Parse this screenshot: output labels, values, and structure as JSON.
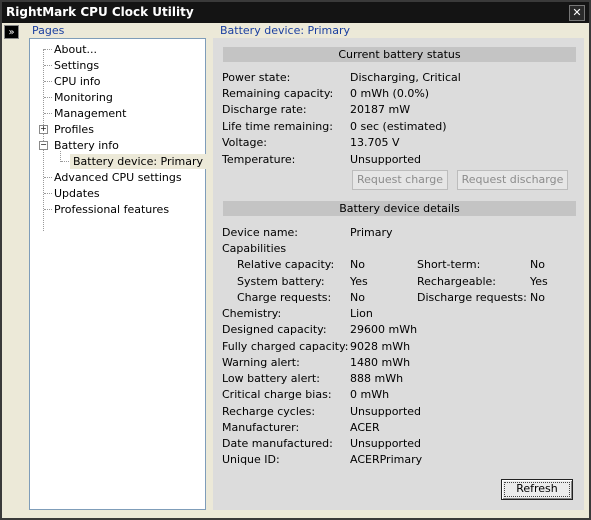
{
  "window": {
    "title": "RightMark CPU Clock Utility",
    "close_glyph": "✕"
  },
  "sidebar": {
    "expand_glyph": "»",
    "header": "Pages",
    "items": {
      "about": "About...",
      "settings": "Settings",
      "cpu_info": "CPU info",
      "monitoring": "Monitoring",
      "management": "Management",
      "profiles": "Profiles",
      "battery_info": "Battery info",
      "battery_device": "Battery device: Primary",
      "advanced_cpu": "Advanced CPU settings",
      "updates": "Updates",
      "professional": "Professional features"
    },
    "toggles": {
      "profiles": "+",
      "battery_info": "−"
    }
  },
  "breadcrumb": "Battery device: Primary",
  "status": {
    "header": "Current battery status",
    "power_state_label": "Power state:",
    "power_state": "Discharging, Critical",
    "remaining_label": "Remaining capacity:",
    "remaining": "0 mWh (0.0%)",
    "discharge_label": "Discharge rate:",
    "discharge": "20187 mW",
    "lifetime_label": "Life time remaining:",
    "lifetime": "0 sec (estimated)",
    "voltage_label": "Voltage:",
    "voltage": "13.705 V",
    "temperature_label": "Temperature:",
    "temperature": "Unsupported",
    "request_charge": "Request charge",
    "request_discharge": "Request discharge"
  },
  "details": {
    "header": "Battery device details",
    "device_name_label": "Device name:",
    "device_name": "Primary",
    "capabilities_label": "Capabilities",
    "relative_label": "Relative capacity:",
    "relative": "No",
    "shortterm_label": "Short-term:",
    "shortterm": "No",
    "system_label": "System battery:",
    "system": "Yes",
    "rechargeable_label": "Rechargeable:",
    "rechargeable": "Yes",
    "charge_req_label": "Charge requests:",
    "charge_req": "No",
    "discharge_req_label": "Discharge requests:",
    "discharge_req": "No",
    "chemistry_label": "Chemistry:",
    "chemistry": "Lion",
    "designed_label": "Designed capacity:",
    "designed": "29600 mWh",
    "full_label": "Fully charged capacity:",
    "full": "9028 mWh",
    "warning_label": "Warning alert:",
    "warning": "1480 mWh",
    "low_label": "Low battery alert:",
    "low": "888 mWh",
    "critical_label": "Critical charge bias:",
    "critical": "0 mWh",
    "cycles_label": "Recharge cycles:",
    "cycles": "Unsupported",
    "manufacturer_label": "Manufacturer:",
    "manufacturer": "ACER",
    "date_label": "Date manufactured:",
    "date": "Unsupported",
    "uid_label": "Unique ID:",
    "uid": "ACERPrimary"
  },
  "refresh_label": "Refresh"
}
